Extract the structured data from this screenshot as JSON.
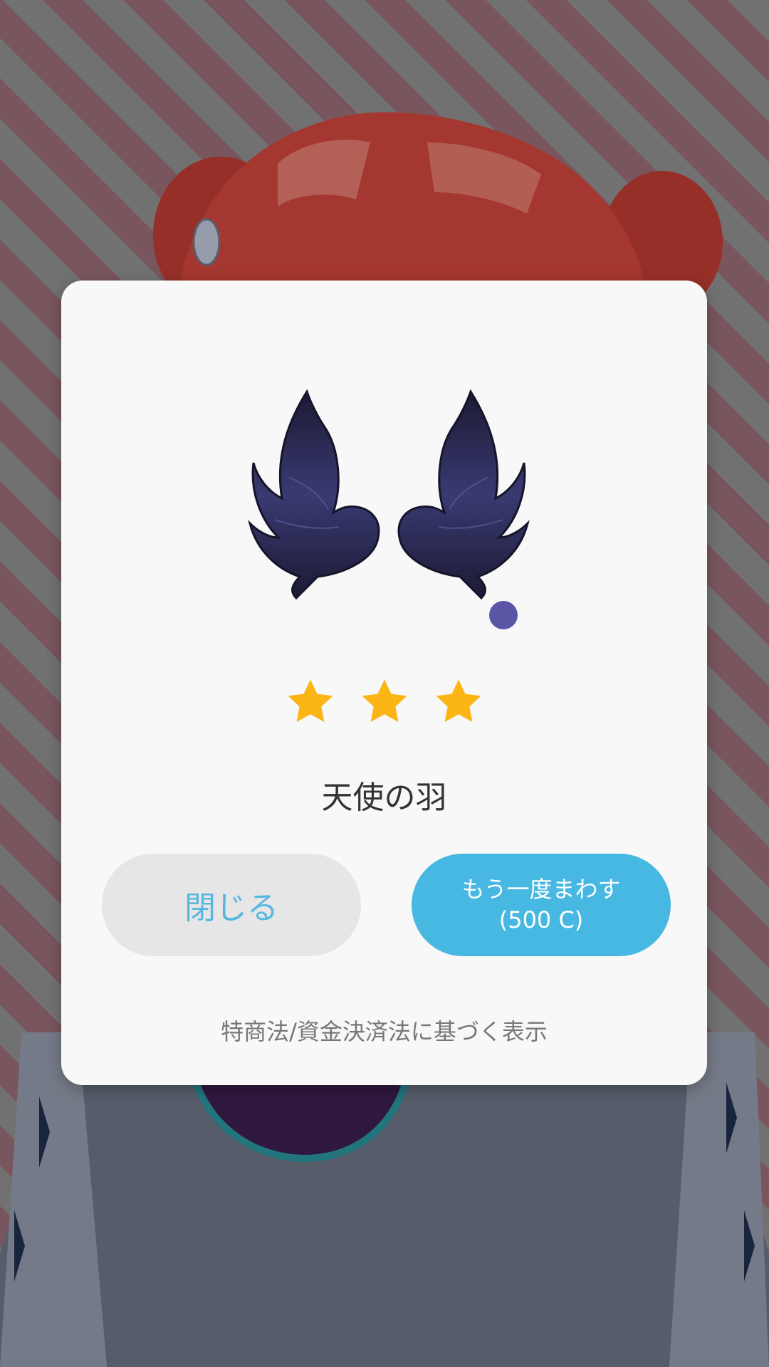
{
  "background": {
    "stripe_colors": [
      "#8a8a8a",
      "#946873"
    ]
  },
  "dialog": {
    "item_icon": "angel-wings-icon",
    "new_indicator_color": "#5a56a5",
    "rarity_stars": 3,
    "star_color": "#fbb515",
    "item_name": "天使の羽",
    "close_button_label": "閉じる",
    "spin_again_label": "もう一度まわす",
    "spin_again_cost": "(500 C)",
    "legal_link": "特商法/資金決済法に基づく表示",
    "colors": {
      "accent_blue": "#47b8e2",
      "close_bg": "#e6e6e6"
    }
  }
}
